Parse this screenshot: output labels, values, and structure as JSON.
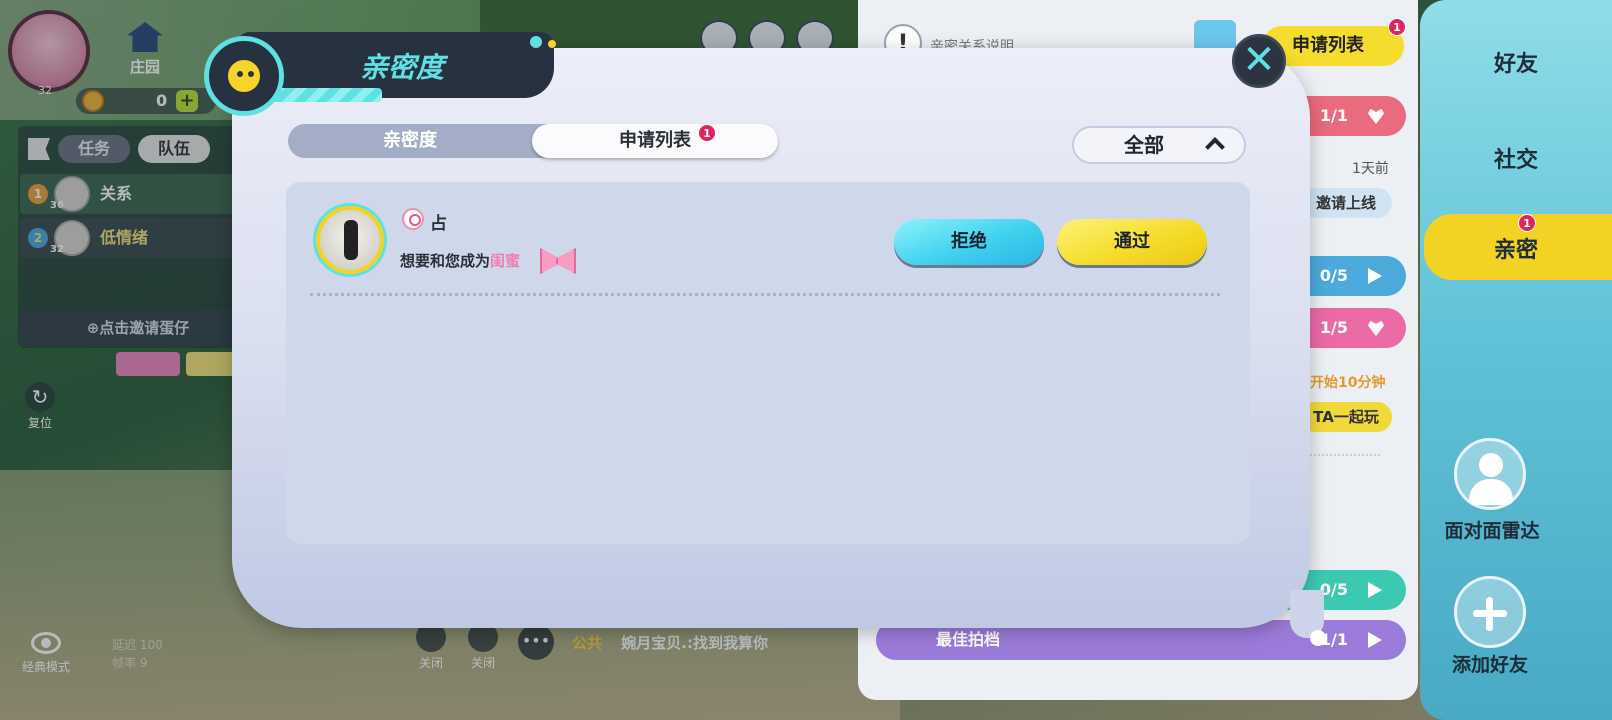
{
  "hud": {
    "player_level": "32",
    "home_label": "庄园",
    "coin_count": "0"
  },
  "left_panel": {
    "tabs": [
      {
        "label": "任务"
      },
      {
        "label": "队伍"
      }
    ],
    "members": [
      {
        "rank": "1",
        "level": "36",
        "name": "关系"
      },
      {
        "rank": "2",
        "level": "32",
        "name": "低情绪"
      }
    ],
    "invite_label": "⊕点击邀请蛋仔",
    "reset_label": "复位",
    "classic_mode_label": "经典模式",
    "stats": [
      "延迟 100",
      "帧率 9"
    ]
  },
  "bottom_chat": {
    "mic_label": "关闭",
    "speaker_label": "关闭",
    "channel": "公共",
    "message": "婉月宝贝.:找到我算你"
  },
  "right_panel": {
    "help_text": "亲密关系说明",
    "apply_list_label": "申请列表",
    "apply_badge": "1",
    "rows": [
      {
        "count": "1/1",
        "color": "#ea6a7e",
        "icon": "heart-icon",
        "label": ""
      },
      {
        "count": "0/5",
        "color": "#4ba9dc",
        "icon": "play-icon",
        "label": ""
      },
      {
        "count": "1/5",
        "color": "#ea6aa6",
        "icon": "heart-icon",
        "label": ""
      },
      {
        "count": "0/5",
        "color": "#3cc9b2",
        "icon": "play-icon",
        "label": ""
      },
      {
        "count": "1/1",
        "color": "#9b7bd9",
        "icon": "play-icon",
        "label": "最佳拍档"
      }
    ],
    "time_ago": "1天前",
    "invite_online": "邀请上线",
    "start_hint": "开始10分钟",
    "play_together": "TA一起玩"
  },
  "sidebar": {
    "items": [
      {
        "label": "好友"
      },
      {
        "label": "社交"
      },
      {
        "label": "亲密",
        "badge": "1"
      }
    ],
    "radar_label": "面对面雷达",
    "add_friend_label": "添加好友"
  },
  "modal": {
    "title": "亲密度",
    "tabs": [
      {
        "label": "亲密度"
      },
      {
        "label": "申请列表",
        "badge": "1"
      }
    ],
    "filter": {
      "selected": "全部"
    },
    "requests": [
      {
        "name": "占",
        "message_prefix": "想要和您成为",
        "relation": "闺蜜",
        "reject_label": "拒绝",
        "accept_label": "通过"
      }
    ]
  },
  "colors": {
    "accent_cyan": "#5fe1e3",
    "accent_yellow": "#f5dd2b",
    "badge_red": "#e0245e"
  }
}
